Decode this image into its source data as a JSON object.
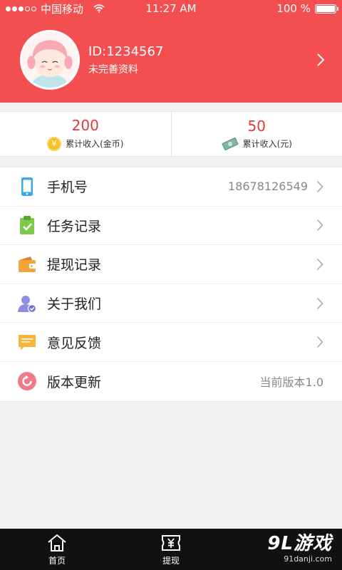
{
  "status_bar": {
    "carrier": "中国移动",
    "time": "11:27 AM",
    "battery": "100 %",
    "battery_level": 1.0
  },
  "profile": {
    "user_id": "ID:1234567",
    "subtitle": "未完善资料",
    "avatar_icon": "cartoon-girl-avatar",
    "chevron_icon": "chevron-right-icon"
  },
  "stats": [
    {
      "value": "200",
      "label": "累计收入(金币)",
      "icon": "coin-icon",
      "icon_glyph": "¥"
    },
    {
      "value": "50",
      "label": "累计收入(元)",
      "icon": "banknote-icon"
    }
  ],
  "menu": {
    "items": [
      {
        "label": "手机号",
        "value": "18678126549",
        "icon": "phone-icon",
        "chevron": true
      },
      {
        "label": "任务记录",
        "value": "",
        "icon": "clipboard-check-icon",
        "chevron": true
      },
      {
        "label": "提现记录",
        "value": "",
        "icon": "wallet-icon",
        "chevron": true
      },
      {
        "label": "关于我们",
        "value": "",
        "icon": "user-verified-icon",
        "chevron": true
      },
      {
        "label": "意见反馈",
        "value": "",
        "icon": "message-icon",
        "chevron": true
      },
      {
        "label": "版本更新",
        "value": "当前版本1.0",
        "icon": "refresh-icon",
        "chevron": false
      }
    ]
  },
  "tabbar": {
    "tabs": [
      {
        "label": "首页",
        "icon": "home-icon"
      },
      {
        "label": "提现",
        "icon": "withdraw-ticket-icon"
      }
    ]
  },
  "watermark": {
    "main": "9L游戏",
    "sub": "91danji.com"
  },
  "colors": {
    "header_red": "#f34f50",
    "stat_red": "#e03b3b",
    "tabbar_black": "#111111"
  }
}
